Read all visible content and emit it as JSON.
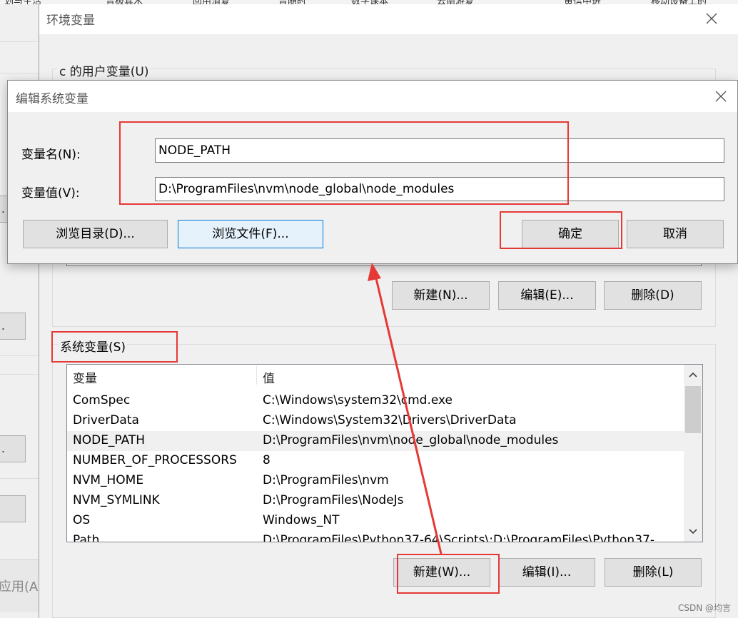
{
  "colors": {
    "annotation_red": "#e53935",
    "dialog_bg": "#f0f0f0",
    "button_bg": "#e1e1e1",
    "focus_blue": "#0078d7"
  },
  "environment_dialog": {
    "title": "环境变量",
    "close_icon": "close-icon",
    "user_section_label": "c 的用户变量(U)",
    "user_buttons": {
      "new": "新建(N)...",
      "edit": "编辑(E)...",
      "delete": "删除(D)"
    },
    "system_section_label": "系统变量(S)",
    "system_columns": [
      "变量",
      "值"
    ],
    "system_variables": [
      {
        "name": "ComSpec",
        "value": "C:\\Windows\\system32\\cmd.exe"
      },
      {
        "name": "DriverData",
        "value": "C:\\Windows\\System32\\Drivers\\DriverData"
      },
      {
        "name": "NODE_PATH",
        "value": "D:\\ProgramFiles\\nvm\\node_global\\node_modules",
        "selected": true
      },
      {
        "name": "NUMBER_OF_PROCESSORS",
        "value": "8"
      },
      {
        "name": "NVM_HOME",
        "value": "D:\\ProgramFiles\\nvm"
      },
      {
        "name": "NVM_SYMLINK",
        "value": "D:\\ProgramFiles\\NodeJs"
      },
      {
        "name": "OS",
        "value": "Windows_NT"
      },
      {
        "name": "Path",
        "value": "D:\\ProgramFiles\\Python37-64\\Scripts\\;D:\\ProgramFiles\\Python37-"
      }
    ],
    "system_buttons": {
      "new": "新建(W)...",
      "edit": "编辑(I)...",
      "delete": "删除(L)"
    }
  },
  "edit_dialog": {
    "title": "编辑系统变量",
    "close_icon": "close-icon",
    "name_label": "变量名(N):",
    "name_value": "NODE_PATH",
    "value_label": "变量值(V):",
    "value_value": "D:\\ProgramFiles\\nvm\\node_global\\node_modules",
    "browse_dir": "浏览目录(D)...",
    "browse_file": "浏览文件(F)...",
    "ok": "确定",
    "cancel": "取消"
  },
  "background": {
    "apply_fragment": "应用(A)",
    "button_fragment": ".",
    "bookmark_fragments": [
      "划与生活",
      "音极其木",
      "回用消复",
      "音随时",
      "数字课本",
      "云南游复",
      "黄信中进",
      "移动设备上的"
    ]
  },
  "watermark": "CSDN @均言"
}
